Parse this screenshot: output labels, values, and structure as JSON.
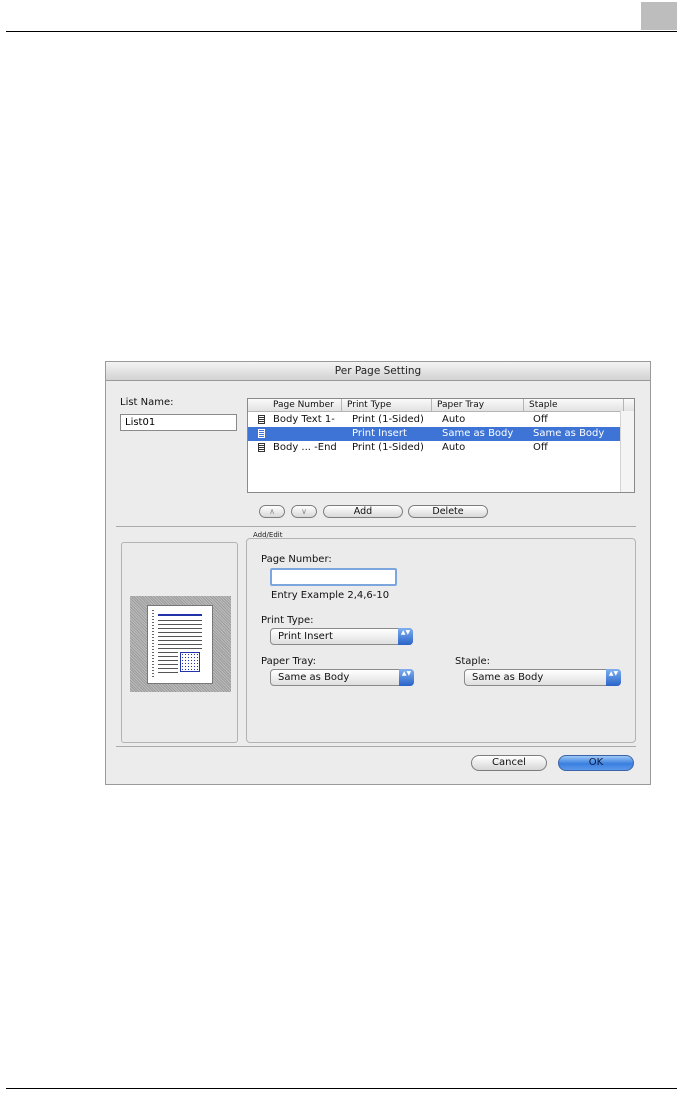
{
  "dialog": {
    "title": "Per Page Setting",
    "list_name_label": "List Name:",
    "list_name_value": "List01"
  },
  "table": {
    "columns": [
      "Page Number",
      "Print Type",
      "Paper Tray",
      "Staple"
    ],
    "rows": [
      {
        "page_number": "Body Text 1-",
        "print_type": "Print (1-Sided)",
        "paper_tray": "Auto",
        "staple": "Off",
        "selected": false
      },
      {
        "page_number": "",
        "print_type": "Print Insert",
        "paper_tray": "Same as Body",
        "staple": "Same as Body",
        "selected": true
      },
      {
        "page_number": "Body ... -End",
        "print_type": "Print (1-Sided)",
        "paper_tray": "Auto",
        "staple": "Off",
        "selected": false
      }
    ]
  },
  "list_buttons": {
    "up": "∧",
    "down": "∨",
    "add": "Add",
    "delete": "Delete"
  },
  "add_edit": {
    "label": "Add/Edit",
    "page_number_label": "Page Number:",
    "page_number_value": "",
    "entry_example": "Entry Example 2,4,6-10",
    "print_type_label": "Print Type:",
    "print_type_value": "Print Insert",
    "paper_tray_label": "Paper Tray:",
    "paper_tray_value": "Same as Body",
    "staple_label": "Staple:",
    "staple_value": "Same as Body"
  },
  "footer": {
    "cancel": "Cancel",
    "ok": "OK"
  },
  "icons": {
    "popup_arrows": "▲▼",
    "row_icon": "document-icon"
  },
  "colors": {
    "selection": "#3d74d6",
    "ok_button": "#3a7fe0",
    "focus_ring": "#7ea6de"
  }
}
